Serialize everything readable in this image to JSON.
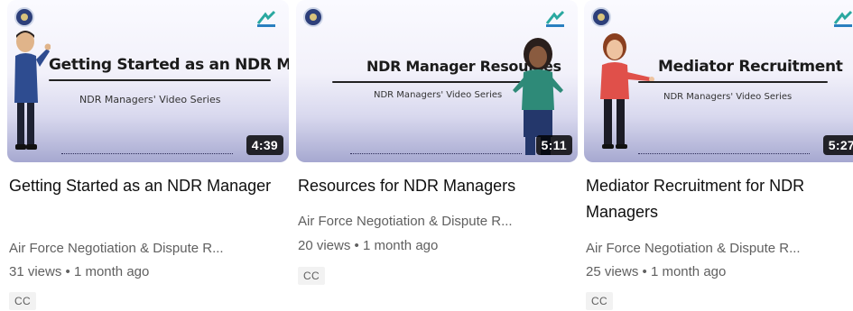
{
  "videos": [
    {
      "thumbnail": {
        "heading": "Getting Started as an NDR Manager",
        "series": "NDR Managers' Video Series",
        "duration": "4:39"
      },
      "title": "Getting Started as an NDR Manager",
      "channel": "Air Force Negotiation & Dispute R...",
      "stats": "31 views • 1 month ago",
      "badge": "CC"
    },
    {
      "thumbnail": {
        "heading": "NDR Manager Resources",
        "series": "NDR Managers' Video Series",
        "duration": "5:11"
      },
      "title": "Resources for NDR Managers",
      "channel": "Air Force Negotiation & Dispute R...",
      "stats": "20 views • 1 month ago",
      "badge": "CC"
    },
    {
      "thumbnail": {
        "heading": "Mediator Recruitment",
        "series": "NDR Managers' Video Series",
        "duration": "5:27"
      },
      "title": "Mediator Recruitment for NDR Managers",
      "channel": "Air Force Negotiation & Dispute R...",
      "stats": "25 views • 1 month ago",
      "badge": "CC"
    }
  ],
  "colors": {
    "title_text": "#0f0f0f",
    "meta_text": "#606060",
    "badge_bg": "#f2f2f2",
    "duration_bg": "#000000"
  }
}
